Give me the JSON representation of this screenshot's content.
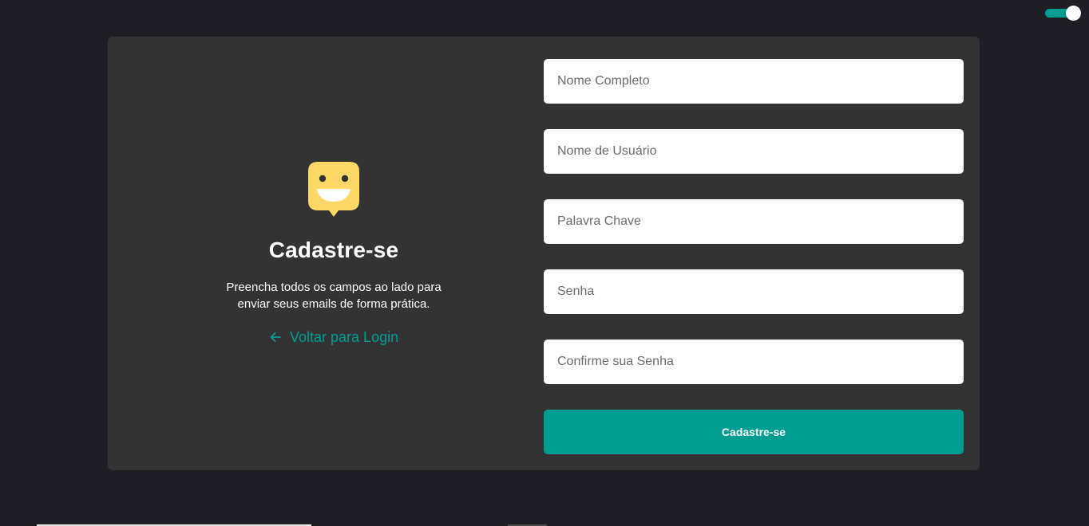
{
  "theme_toggle": {
    "state": "on",
    "accent": "#009e92"
  },
  "intro": {
    "logo_icon": "smiley-speech-bubble-icon",
    "heading": "Cadastre-se",
    "description": "Preencha todos os campos ao lado para enviar seus emails de forma prática.",
    "back_link": {
      "icon": "arrow-left-icon",
      "label": "Voltar para Login"
    }
  },
  "form": {
    "fields": [
      {
        "name": "full-name",
        "placeholder": "Nome Completo",
        "value": ""
      },
      {
        "name": "username",
        "placeholder": "Nome de Usuário",
        "value": ""
      },
      {
        "name": "keyword",
        "placeholder": "Palavra Chave",
        "value": ""
      },
      {
        "name": "password",
        "placeholder": "Senha",
        "value": ""
      },
      {
        "name": "confirm-password",
        "placeholder": "Confirme sua Senha",
        "value": ""
      }
    ],
    "submit_label": "Cadastre-se"
  },
  "colors": {
    "background": "#1f1e24",
    "card": "#333333",
    "accent": "#009e92",
    "logo": "#fed866"
  }
}
